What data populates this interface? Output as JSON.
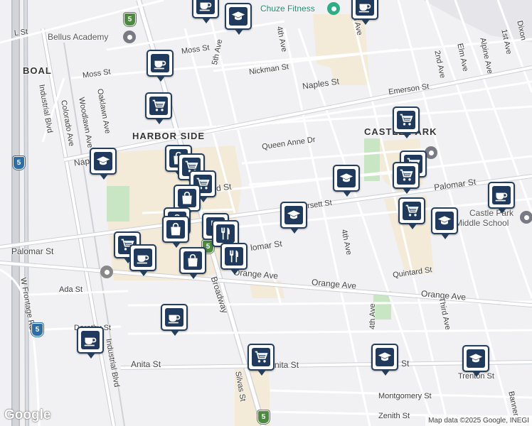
{
  "map": {
    "attribution": "Map data ©2025 Google, INEGI",
    "logo": "Google",
    "neighborhoods": {
      "boal": "BOAL",
      "harbor_side": "HARBOR SIDE",
      "castle_park": "CASTLE PARK"
    },
    "streets": {
      "l_st": "L St",
      "moss_st_1": "Moss St",
      "moss_st_2": "Moss St",
      "nickman": "Nickman St",
      "naples_1": "Naples St",
      "naples_2": "Napl",
      "emerson": "Emerson St",
      "queen_anne": "Queen Anne Dr",
      "oxford": "d St",
      "dorsett": "rsett St",
      "palomar_1": "Palomar St",
      "palomar_2": "lomar St",
      "palomar_3": "Palomar St",
      "orange_1": "Orange Ave",
      "orange_2": "Orange Ave",
      "orange_3": "Orange Ave",
      "quintard": "Quintard St",
      "ada": "Ada St",
      "dorothy": "Dorothy St",
      "anita_1": "Anita St",
      "anita_2": "Anita St",
      "anita_3": "St",
      "trenton": "Trenton St",
      "montgomery": "Montgomery St",
      "zenith": "Zenith St",
      "fifth_ave": "5th Ave",
      "fourth_ave_1": "4th Ave",
      "fourth_ave_2": "4th Ave",
      "fourth_ave_3": "4th Ave",
      "third_ave_1": "rd Ave",
      "third_ave_2": "Third Ave",
      "second_ave": "2nd Ave",
      "first_ave": "1st Ave",
      "elm": "Elm Ave",
      "alpine": "Alpine Ave",
      "dixon": "Dixon",
      "banner": "Banner",
      "industrial_1": "Industrial Blvd",
      "industrial_2": "Industrial Blvd",
      "colorado": "Colorado Ave",
      "woodlawn": "Woodlawn Ave",
      "oaklawn": "Oaklawn Ave",
      "broadway": "Broadway",
      "silvas": "Silvas St",
      "w_frontage": "W Frontage Rd"
    },
    "pois": {
      "chuze": "Chuze Fitness",
      "bellus": "Bellus Academy",
      "castle_park_ms_1": "Castle Park",
      "castle_park_ms_2": "Middle School"
    },
    "shields": {
      "i5": "5"
    },
    "marker_colors": {
      "frame": "#243e5c",
      "icon_bg": "#1f3a5c"
    },
    "markers": [
      {
        "type": "coffee-icon"
      },
      {
        "type": "school-icon"
      },
      {
        "type": "coffee-icon"
      },
      {
        "type": "coffee-icon"
      },
      {
        "type": "shopping-cart-icon"
      },
      {
        "type": "school-icon"
      },
      {
        "type": "shopping-cart-icon"
      },
      {
        "type": "shopping-bag-icon"
      },
      {
        "type": "shopping-cart-icon"
      },
      {
        "type": "shopping-cart-icon"
      },
      {
        "type": "shopping-bag-icon"
      },
      {
        "type": "school-icon"
      },
      {
        "type": "shopping-cart-icon"
      },
      {
        "type": "shopping-cart-icon"
      },
      {
        "type": "shopping-cart-icon"
      },
      {
        "type": "school-icon"
      },
      {
        "type": "school-icon"
      },
      {
        "type": "coffee-icon"
      },
      {
        "type": "shopping-cart-icon"
      },
      {
        "type": "shopping-bag-icon"
      },
      {
        "type": "shopping-bag-icon"
      },
      {
        "type": "restaurant-icon"
      },
      {
        "type": "restaurant-icon"
      },
      {
        "type": "restaurant-icon"
      },
      {
        "type": "shopping-bag-icon"
      },
      {
        "type": "coffee-icon"
      },
      {
        "type": "coffee-icon"
      },
      {
        "type": "coffee-icon"
      },
      {
        "type": "shopping-cart-icon"
      },
      {
        "type": "school-icon"
      },
      {
        "type": "school-icon"
      }
    ]
  }
}
